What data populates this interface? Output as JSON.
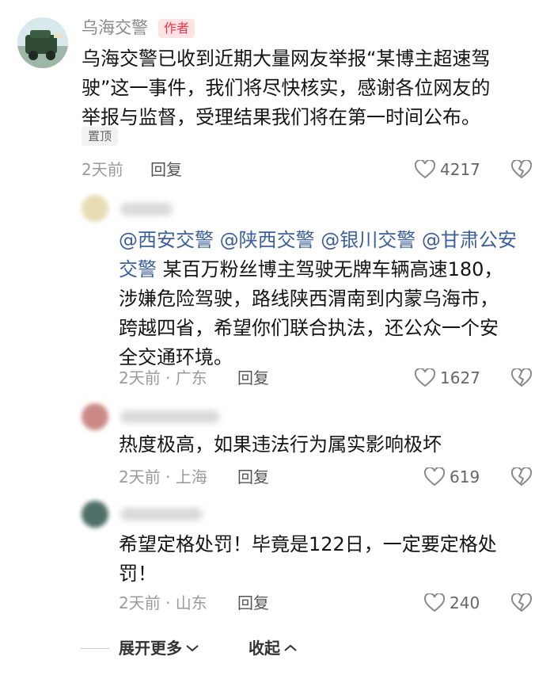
{
  "author_comment": {
    "name": "乌海交警",
    "badge": "作者",
    "lines": [
      "乌海交警已收到近期大量网友举报“某博主超速驾",
      "驶”这一事件，我们将尽快核实，感谢各位网友的",
      "举报与监督，受理结果我们将在第一时间公布。"
    ],
    "pinned_label": "置顶",
    "time": "2天前",
    "reply_label": "回复",
    "likes": "4217"
  },
  "comments": [
    {
      "mentions": [
        "@西安交警",
        "@陕西交警",
        "@银川交警",
        "@甘肃公安"
      ],
      "line2_mention": "交警",
      "line2_text": " 某百万粉丝博主驾驶无牌车辆高速180，",
      "lines_rest": [
        "涉嫌危险驾驶，路线陕西渭南到内蒙乌海市，",
        "跨越四省，希望你们联合执法，还公众一个安",
        "全交通环境。"
      ],
      "time_location": "2天前 · 广东",
      "reply_label": "回复",
      "likes": "1627"
    },
    {
      "lines": [
        "热度极高，如果违法行为属实影响极坏"
      ],
      "time_location": "2天前 · 上海",
      "reply_label": "回复",
      "likes": "619"
    },
    {
      "lines": [
        "希望定格处罚！毕竟是122日，一定要定格处",
        "罚！"
      ],
      "time_location": "2天前 · 山东",
      "reply_label": "回复",
      "likes": "240"
    }
  ],
  "footer": {
    "expand_label": "展开更多",
    "collapse_label": "收起"
  },
  "icons": {
    "like": "heart-outline-icon",
    "dislike": "broken-heart-icon",
    "expand": "chevron-down-icon",
    "collapse": "chevron-up-icon"
  },
  "colors": {
    "badge_text": "#f0364c",
    "badge_bg": "#fde3e4",
    "mention": "#3c5f9a"
  }
}
